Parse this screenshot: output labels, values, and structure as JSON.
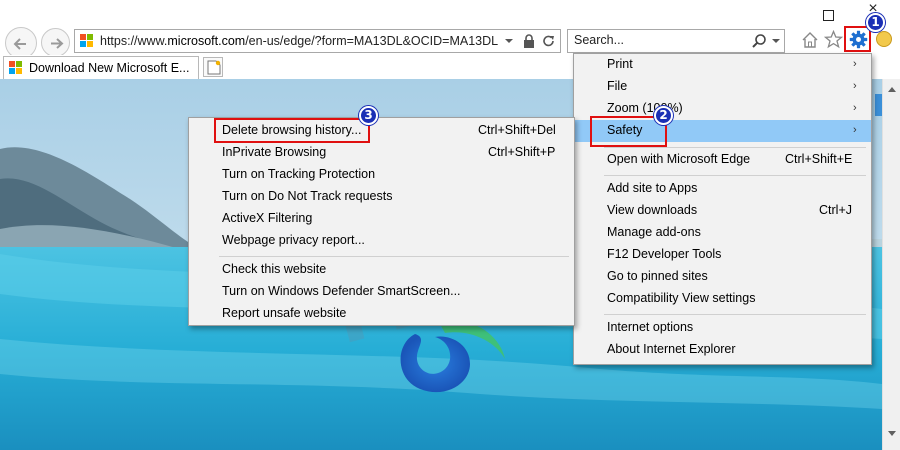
{
  "window": {
    "maximize_icon": "maximize-icon",
    "close_icon": "close-icon"
  },
  "nav": {
    "back_icon": "back-arrow-icon",
    "forward_icon": "forward-arrow-icon"
  },
  "address": {
    "prefix": "https://www.",
    "domain": "microsoft.com",
    "path": "/en-us/edge/?form=MA13DL&OCID=MA13DL"
  },
  "search": {
    "placeholder": "Search..."
  },
  "tab": {
    "title": "Download New Microsoft E..."
  },
  "badges": {
    "step1": "1",
    "step2": "2",
    "step3": "3"
  },
  "tools_menu": {
    "items": [
      {
        "label": "Print",
        "shortcut": "",
        "arrow": "›"
      },
      {
        "label": "File",
        "shortcut": "",
        "arrow": "›"
      },
      {
        "label": "Zoom (100%)",
        "shortcut": "",
        "arrow": "›"
      },
      {
        "label": "Safety",
        "shortcut": "",
        "arrow": "›"
      },
      {
        "label": "Open with Microsoft Edge",
        "shortcut": "Ctrl+Shift+E"
      },
      {
        "label": "Add site to Apps",
        "shortcut": ""
      },
      {
        "label": "View downloads",
        "shortcut": "Ctrl+J"
      },
      {
        "label": "Manage add-ons",
        "shortcut": ""
      },
      {
        "label": "F12 Developer Tools",
        "shortcut": ""
      },
      {
        "label": "Go to pinned sites",
        "shortcut": ""
      },
      {
        "label": "Compatibility View settings",
        "shortcut": ""
      },
      {
        "label": "Internet options",
        "shortcut": ""
      },
      {
        "label": "About Internet Explorer",
        "shortcut": ""
      }
    ]
  },
  "safety_menu": {
    "items": [
      {
        "label": "Delete browsing history...",
        "shortcut": "Ctrl+Shift+Del"
      },
      {
        "label": "InPrivate Browsing",
        "shortcut": "Ctrl+Shift+P"
      },
      {
        "label": "Turn on Tracking Protection",
        "shortcut": ""
      },
      {
        "label": "Turn on Do Not Track requests",
        "shortcut": ""
      },
      {
        "label": "ActiveX Filtering",
        "shortcut": ""
      },
      {
        "label": "Webpage privacy report...",
        "shortcut": ""
      },
      {
        "label": "Check this website",
        "shortcut": ""
      },
      {
        "label": "Turn on Windows Defender SmartScreen...",
        "shortcut": ""
      },
      {
        "label": "Report unsafe website",
        "shortcut": ""
      }
    ]
  },
  "colors": {
    "highlight": "#91c9f7",
    "callout_red": "#e01010",
    "badge_blue": "#1a2fb5",
    "sky": "#7fb9de",
    "water": "#2fb4d8"
  }
}
